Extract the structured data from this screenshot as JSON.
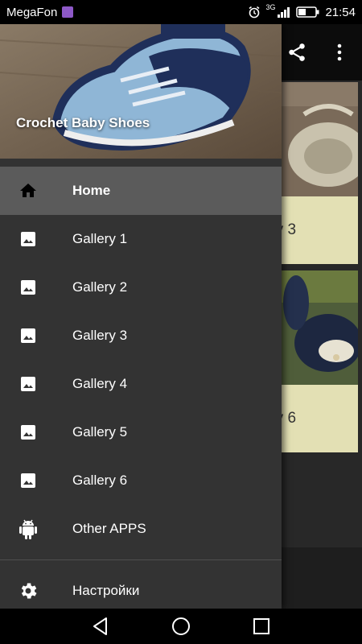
{
  "status_bar": {
    "carrier": "MegaFon",
    "network_type": "3G",
    "time": "21:54"
  },
  "drawer": {
    "title": "Crochet Baby Shoes",
    "items": [
      {
        "label": "Home",
        "icon": "home-icon",
        "active": true
      },
      {
        "label": "Gallery 1",
        "icon": "image-icon"
      },
      {
        "label": "Gallery 2",
        "icon": "image-icon"
      },
      {
        "label": "Gallery 3",
        "icon": "image-icon"
      },
      {
        "label": "Gallery 4",
        "icon": "image-icon"
      },
      {
        "label": "Gallery 5",
        "icon": "image-icon"
      },
      {
        "label": "Gallery 6",
        "icon": "image-icon"
      },
      {
        "label": "Other APPS",
        "icon": "android-icon"
      }
    ],
    "settings_label": "Настройки"
  },
  "background": {
    "tiles": [
      {
        "caption": "Gallery 3"
      },
      {
        "caption": "Gallery 6"
      }
    ]
  },
  "colors": {
    "drawer_bg": "#333333",
    "active_item_bg": "#5b5b5b",
    "tile_caption_bg": "#e3e0b4",
    "sim_badge": "#8e59c8"
  }
}
